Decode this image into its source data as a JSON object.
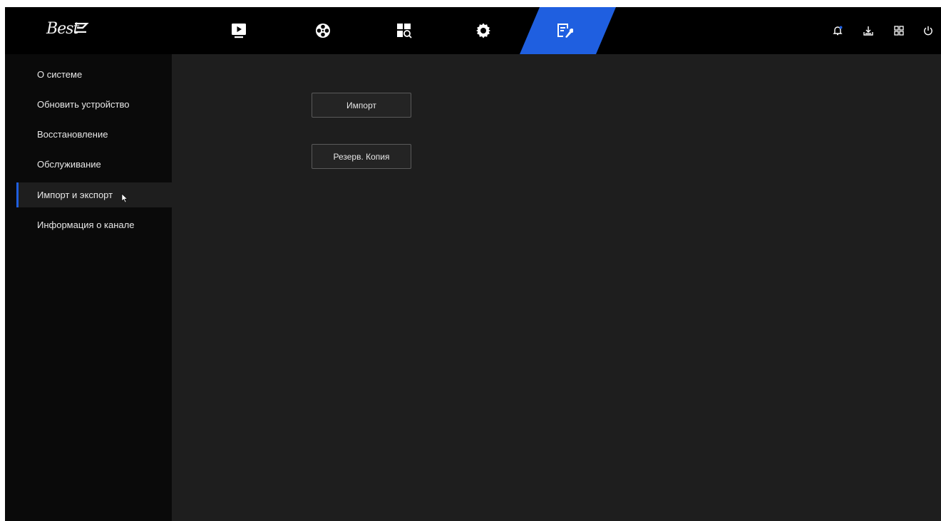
{
  "brand": {
    "logo_text": "Best"
  },
  "topbar": {
    "tabs": [
      {
        "icon": "playback-icon"
      },
      {
        "icon": "film-reel-icon"
      },
      {
        "icon": "search-grid-icon"
      },
      {
        "icon": "settings-gear-icon"
      },
      {
        "icon": "maintenance-tools-icon",
        "active": true
      }
    ],
    "right_icons": [
      "notification-bell-icon",
      "download-icon",
      "layout-grid-icon",
      "power-icon"
    ]
  },
  "sidebar": {
    "items": [
      {
        "label": "О системе"
      },
      {
        "label": "Обновить устройство"
      },
      {
        "label": "Восстановление"
      },
      {
        "label": "Обслуживание"
      },
      {
        "label": "Импорт и экспорт",
        "active": true
      },
      {
        "label": "Информация о канале"
      }
    ]
  },
  "main": {
    "import_label": "Импорт",
    "backup_label": "Резерв. Копия"
  },
  "colors": {
    "accent": "#1f5fe0",
    "background": "#1e1e1e",
    "topbar": "#000000",
    "sidebar": "#0a0a0a"
  }
}
